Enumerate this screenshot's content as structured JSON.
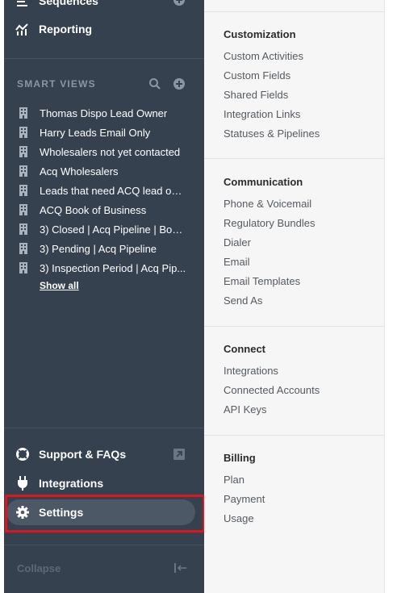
{
  "sidebar": {
    "top_items": [
      {
        "label": "Sequences",
        "icon": "list-icon"
      },
      {
        "label": "Reporting",
        "icon": "chart-icon"
      }
    ],
    "smart_views": {
      "title": "SMART VIEWS",
      "items": [
        "Thomas Dispo Lead Owner",
        "Harry Leads Email Only",
        "Wholesalers not yet contacted",
        "Acq Wholesalers",
        "Leads that need ACQ lead ow...",
        "ACQ Book of Business",
        "3) Closed | Acq Pipeline | Boo...",
        "3) Pending | Acq Pipeline",
        "3) Inspection Period | Acq Pip..."
      ],
      "show_all": "Show all"
    },
    "bottom_items": [
      {
        "label": "Support & FAQs",
        "icon": "lifebuoy-icon"
      },
      {
        "label": "Integrations",
        "icon": "plug-icon"
      },
      {
        "label": "Settings",
        "icon": "gear-icon"
      }
    ],
    "collapse": "Collapse"
  },
  "settings_menu": {
    "customization": {
      "title": "Customization",
      "links": [
        "Custom Activities",
        "Custom Fields",
        "Shared Fields",
        "Integration Links",
        "Statuses & Pipelines"
      ]
    },
    "communication": {
      "title": "Communication",
      "links": [
        "Phone & Voicemail",
        "Regulatory Bundles",
        "Dialer",
        "Email",
        "Email Templates",
        "Send As"
      ]
    },
    "connect": {
      "title": "Connect",
      "links": [
        "Integrations",
        "Connected Accounts",
        "API Keys"
      ]
    },
    "billing": {
      "title": "Billing",
      "links": [
        "Plan",
        "Payment",
        "Usage"
      ]
    }
  },
  "colors": {
    "sidebar_bg": "#364150",
    "active_pill": "#4d5867",
    "highlight": "#e0151b",
    "content_bg": "#f6f6f6"
  }
}
